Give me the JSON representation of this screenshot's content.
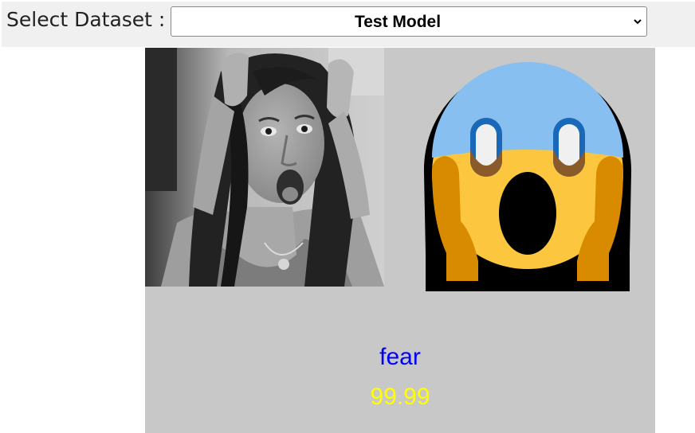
{
  "header": {
    "label": "Select Dataset :",
    "selected_dataset": "Test Model"
  },
  "result": {
    "emotion": "fear",
    "confidence": "99.99",
    "emoji_icon": "fearful-screaming-face-icon"
  },
  "colors": {
    "emotion_text": "#0000ff",
    "confidence_text": "#ffff00",
    "panel_background": "#c8c8c8"
  }
}
